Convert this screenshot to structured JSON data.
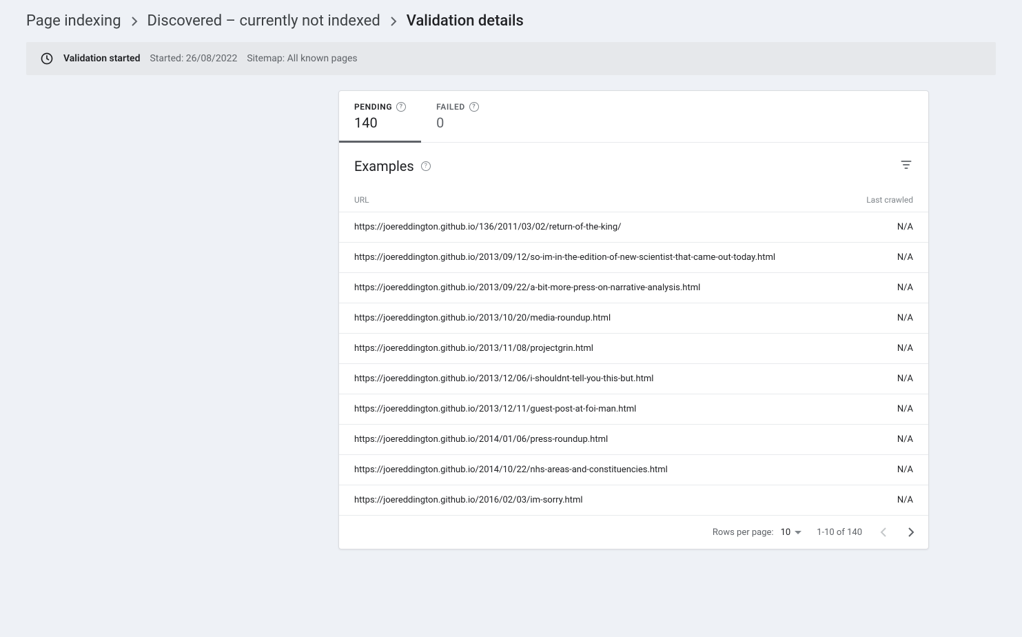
{
  "breadcrumb": {
    "item1": "Page indexing",
    "item2": "Discovered – currently not indexed",
    "item3": "Validation details"
  },
  "status": {
    "title": "Validation started",
    "started_label": "Started: 26/08/2022",
    "sitemap_label": "Sitemap: All known pages"
  },
  "tabs": {
    "pending": {
      "label": "PENDING",
      "count": "140"
    },
    "failed": {
      "label": "FAILED",
      "count": "0"
    }
  },
  "examples": {
    "title": "Examples",
    "columns": {
      "url": "URL",
      "crawled": "Last crawled"
    },
    "rows": [
      {
        "url": "https://joereddington.github.io/136/2011/03/02/return-of-the-king/",
        "crawled": "N/A"
      },
      {
        "url": "https://joereddington.github.io/2013/09/12/so-im-in-the-edition-of-new-scientist-that-came-out-today.html",
        "crawled": "N/A"
      },
      {
        "url": "https://joereddington.github.io/2013/09/22/a-bit-more-press-on-narrative-analysis.html",
        "crawled": "N/A"
      },
      {
        "url": "https://joereddington.github.io/2013/10/20/media-roundup.html",
        "crawled": "N/A"
      },
      {
        "url": "https://joereddington.github.io/2013/11/08/projectgrin.html",
        "crawled": "N/A"
      },
      {
        "url": "https://joereddington.github.io/2013/12/06/i-shouldnt-tell-you-this-but.html",
        "crawled": "N/A"
      },
      {
        "url": "https://joereddington.github.io/2013/12/11/guest-post-at-foi-man.html",
        "crawled": "N/A"
      },
      {
        "url": "https://joereddington.github.io/2014/01/06/press-roundup.html",
        "crawled": "N/A"
      },
      {
        "url": "https://joereddington.github.io/2014/10/22/nhs-areas-and-constituencies.html",
        "crawled": "N/A"
      },
      {
        "url": "https://joereddington.github.io/2016/02/03/im-sorry.html",
        "crawled": "N/A"
      }
    ]
  },
  "pagination": {
    "rows_label": "Rows per page:",
    "rows_value": "10",
    "range": "1-10 of 140"
  }
}
